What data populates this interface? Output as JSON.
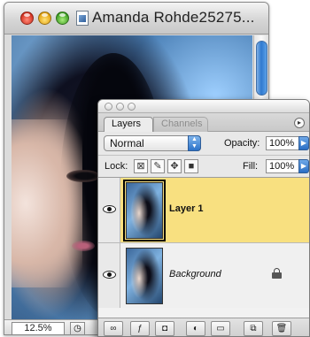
{
  "document": {
    "title": "Amanda Rohde25275...",
    "zoom": "12.5%"
  },
  "palette": {
    "tabs": [
      {
        "label": "Layers"
      },
      {
        "label": "Channels"
      }
    ],
    "blend_mode": "Normal",
    "opacity_label": "Opacity:",
    "opacity_value": "100%",
    "lock_label": "Lock:",
    "fill_label": "Fill:",
    "fill_value": "100%",
    "layers": [
      {
        "name": "Layer 1",
        "selected": true,
        "visible": true,
        "locked": false
      },
      {
        "name": "Background",
        "selected": false,
        "visible": true,
        "locked": true
      }
    ],
    "footer_icons": [
      "link-icon",
      "layer-style-icon",
      "mask-icon",
      "adjustment-icon",
      "folder-icon",
      "new-layer-icon",
      "trash-icon"
    ]
  },
  "colors": {
    "selected_layer": "#f8e080",
    "accent_blue": "#2c73c9"
  }
}
